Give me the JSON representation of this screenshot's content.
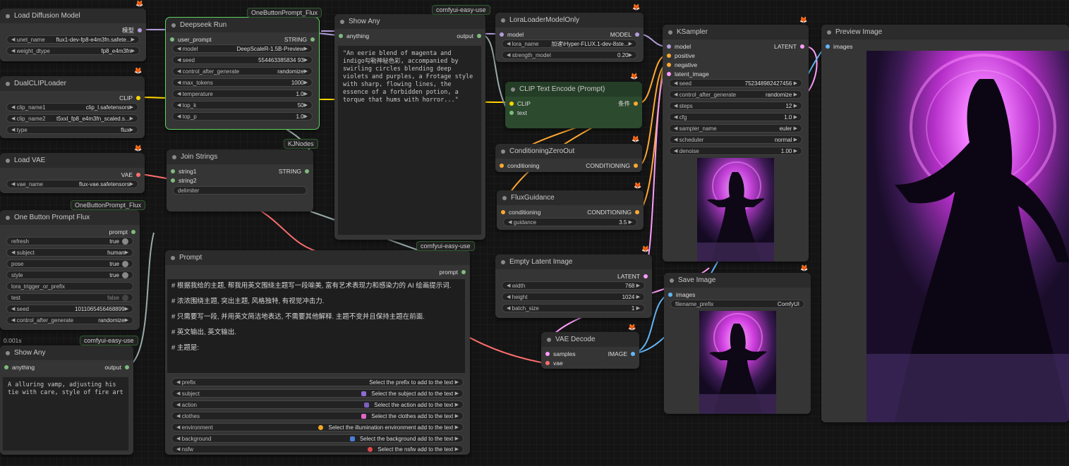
{
  "colors": {
    "model": "#b39ddb",
    "clip": "#ffd500",
    "vae": "#ff6e6e",
    "latent": "#ff9cf9",
    "conditioning": "#ffa931",
    "image": "#64b5f6",
    "string": "#7dbc7d",
    "group_border": "#5fd35f"
  },
  "badges": {
    "obp_flux_1": "OneButtonPrompt_Flux",
    "easy_use_1": "comfyui-easy-use",
    "kjnodes": "KJNodes",
    "obp_flux_2": "OneButtonPrompt_Flux",
    "easy_use_2": "comfyui-easy-use",
    "easy_use_3": "comfyui-easy-use"
  },
  "load_diffusion": {
    "title": "Load Diffusion Model",
    "out": "模型",
    "unet_name_label": "unet_name",
    "unet_name": "flux1-dev-fp8-e4m3fn.safete...",
    "weight_dtype_label": "weight_dtype",
    "weight_dtype": "fp8_e4m3fn"
  },
  "dualclip": {
    "title": "DualCLIPLoader",
    "out": "CLIP",
    "clip_name1_label": "clip_name1",
    "clip_name1": "clip_l.safetensors",
    "clip_name2_label": "clip_name2",
    "clip_name2": "t5xxl_fp8_e4m3fn_scaled.s...",
    "type_label": "type",
    "type": "flux"
  },
  "load_vae": {
    "title": "Load VAE",
    "out": "VAE",
    "vae_name_label": "vae_name",
    "vae_name": "flux-vae.safetensors"
  },
  "obp": {
    "title": "One Button Prompt Flux",
    "out": "prompt",
    "rows": [
      {
        "label": "refresh",
        "value": "true",
        "kind": "toggle"
      },
      {
        "label": "subject",
        "value": "human",
        "kind": "combo"
      },
      {
        "label": "pose",
        "value": "true",
        "kind": "toggle"
      },
      {
        "label": "style",
        "value": "true",
        "kind": "toggle"
      },
      {
        "label": "lora_trigger_or_prefix",
        "value": "",
        "kind": "text"
      },
      {
        "label": "test",
        "value": "false",
        "kind": "toggle"
      },
      {
        "label": "seed",
        "value": "1011065456468899",
        "kind": "combo"
      },
      {
        "label": "control_after_generate",
        "value": "randomize",
        "kind": "combo"
      }
    ]
  },
  "time_label": "0.001s",
  "show_any_small": {
    "title": "Show Any",
    "in": "anything",
    "out": "output",
    "text": "A alluring vamp, adjusting his tie with care, style of fire art"
  },
  "deepseek": {
    "title": "Deepseek Run",
    "in": "user_prompt",
    "out": "STRING",
    "rows": [
      {
        "label": "model",
        "value": "DeepScaleR-1.5B-Preview"
      },
      {
        "label": "seed",
        "value": "554463385834 93"
      },
      {
        "label": "control_after_generate",
        "value": "randomize"
      },
      {
        "label": "max_tokens",
        "value": "1000"
      },
      {
        "label": "temperature",
        "value": "1.0"
      },
      {
        "label": "top_k",
        "value": "50"
      },
      {
        "label": "top_p",
        "value": "1.0"
      }
    ]
  },
  "join": {
    "title": "Join Strings",
    "in1": "string1",
    "in2": "string2",
    "out": "STRING",
    "delimiter": "delimiter"
  },
  "show_any_big": {
    "title": "Show Any",
    "in": "anything",
    "out": "output",
    "text": "\"An eerie blend of magenta and indigo勾勒神秘色彩, accompanied by swirling circles blending deep violets and purples, a Frotage style with sharp, flowing lines, the essence of a forbidden potion, a torque that hums with horror...\""
  },
  "prompt": {
    "title": "Prompt",
    "out": "prompt",
    "lines": [
      "# 根据我给的主题, 帮我用英文围绕主题写一段喻美, 富有艺术表现力和感染力的 AI 绘画提示词.",
      "# 浓浓围绕主题, 突出主题, 风格独特, 有视觉冲击力.",
      "# 只需要写一段, 并用英文简洁地表达, 不需要其他解释. 主题不变并且保持主题在前面.",
      "# 英文输出, 英文输出.",
      "# 主题是:"
    ],
    "rows": [
      {
        "label": "prefix",
        "value": "Select the prefix to add to the text",
        "sw": ""
      },
      {
        "label": "subject",
        "value": "Select the subject add to the text",
        "sw": "#8e6bd6"
      },
      {
        "label": "action",
        "value": "Select the action add to the text",
        "sw": "#7d5fc0"
      },
      {
        "label": "clothes",
        "value": "Select the clothes add to the text",
        "sw": "#e066c8"
      },
      {
        "label": "environment",
        "value": "Select the illumination environment add to the text",
        "sw": "#f2a623"
      },
      {
        "label": "background",
        "value": "Select the background add to the text",
        "sw": "#4a7fd6"
      },
      {
        "label": "nsfw",
        "value": "Select the nsfw add to the text",
        "sw": "#e04848"
      }
    ]
  },
  "lora": {
    "title": "LoraLoaderModelOnly",
    "in": "model",
    "out": "MODEL",
    "lora_name_label": "lora_name",
    "lora_name": "加速\\Hyper-FLUX.1-dev-8ste...",
    "strength_label": "strength_model",
    "strength": "0.20"
  },
  "clip_encode": {
    "title": "CLIP Text Encode (Prompt)",
    "in1": "CLIP",
    "in2": "text",
    "out": "条件"
  },
  "cond_zero": {
    "title": "ConditioningZeroOut",
    "in": "conditioning",
    "out": "CONDITIONING"
  },
  "flux_guid": {
    "title": "FluxGuidance",
    "in": "conditioning",
    "out": "CONDITIONING",
    "guidance_label": "guidance",
    "guidance": "3.5"
  },
  "empty_latent": {
    "title": "Empty Latent Image",
    "out": "LATENT",
    "rows": [
      {
        "label": "width",
        "value": "768"
      },
      {
        "label": "height",
        "value": "1024"
      },
      {
        "label": "batch_size",
        "value": "1"
      }
    ]
  },
  "vae_decode": {
    "title": "VAE Decode",
    "in1": "samples",
    "in2": "vae",
    "out": "IMAGE"
  },
  "ksampler": {
    "title": "KSampler",
    "out": "LATENT",
    "inputs": [
      "model",
      "positive",
      "negative",
      "latent_image"
    ],
    "rows": [
      {
        "label": "seed",
        "value": "752348982427456"
      },
      {
        "label": "control_after_generate",
        "value": "randomize"
      },
      {
        "label": "steps",
        "value": "12"
      },
      {
        "label": "cfg",
        "value": "1.0"
      },
      {
        "label": "sampler_name",
        "value": "euler"
      },
      {
        "label": "scheduler",
        "value": "normal"
      },
      {
        "label": "denoise",
        "value": "1.00"
      }
    ]
  },
  "save_image": {
    "title": "Save Image",
    "in": "images",
    "prefix_label": "filename_prefix",
    "prefix": "ComfyUI"
  },
  "preview": {
    "title": "Preview Image",
    "in": "images"
  }
}
